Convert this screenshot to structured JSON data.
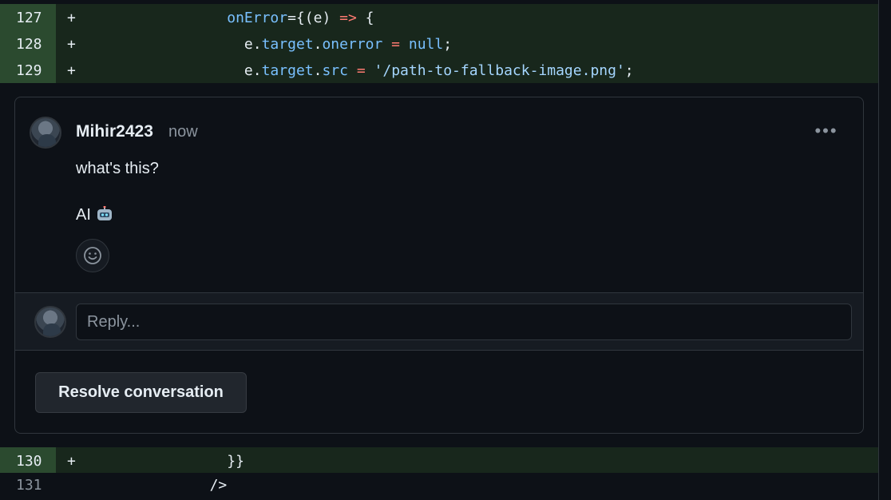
{
  "diff": {
    "top_lines": [
      {
        "num": "127",
        "marker": "+",
        "indent": "                 ",
        "tokens": [
          [
            "attr",
            "onError"
          ],
          [
            "plain",
            "={(e) "
          ],
          [
            "op",
            "=>"
          ],
          [
            "plain",
            " {"
          ]
        ]
      },
      {
        "num": "128",
        "marker": "+",
        "indent": "                   ",
        "tokens": [
          [
            "plain",
            "e."
          ],
          [
            "attr",
            "target"
          ],
          [
            "plain",
            "."
          ],
          [
            "attr",
            "onerror"
          ],
          [
            "plain",
            " "
          ],
          [
            "op",
            "="
          ],
          [
            "plain",
            " "
          ],
          [
            "kw",
            "null"
          ],
          [
            "plain",
            ";"
          ]
        ]
      },
      {
        "num": "129",
        "marker": "+",
        "indent": "                   ",
        "tokens": [
          [
            "plain",
            "e."
          ],
          [
            "attr",
            "target"
          ],
          [
            "plain",
            "."
          ],
          [
            "attr",
            "src"
          ],
          [
            "plain",
            " "
          ],
          [
            "op",
            "="
          ],
          [
            "plain",
            " "
          ],
          [
            "str",
            "'/path-to-fallback-image.png'"
          ],
          [
            "plain",
            ";"
          ]
        ]
      }
    ],
    "bottom_lines": [
      {
        "num": "130",
        "marker": "+",
        "type": "added",
        "indent": "                 ",
        "tokens": [
          [
            "plain",
            "}}"
          ]
        ]
      },
      {
        "num": "131",
        "marker": "",
        "type": "ctx",
        "indent": "               ",
        "tokens": [
          [
            "plain",
            "/>"
          ]
        ]
      }
    ]
  },
  "comment": {
    "author": "Mihir2423",
    "time": "now",
    "more_label": "•••",
    "body_line1": "what's this?",
    "body_line2": "AI"
  },
  "reply": {
    "placeholder": "Reply..."
  },
  "resolve_label": "Resolve conversation",
  "colors": {
    "added_bg": "#18271c",
    "added_num_bg": "#2b4a2f",
    "border": "#30363d",
    "bg": "#0d1117"
  },
  "icons": [
    "more-icon",
    "robot-icon",
    "emoji-icon",
    "avatar"
  ]
}
